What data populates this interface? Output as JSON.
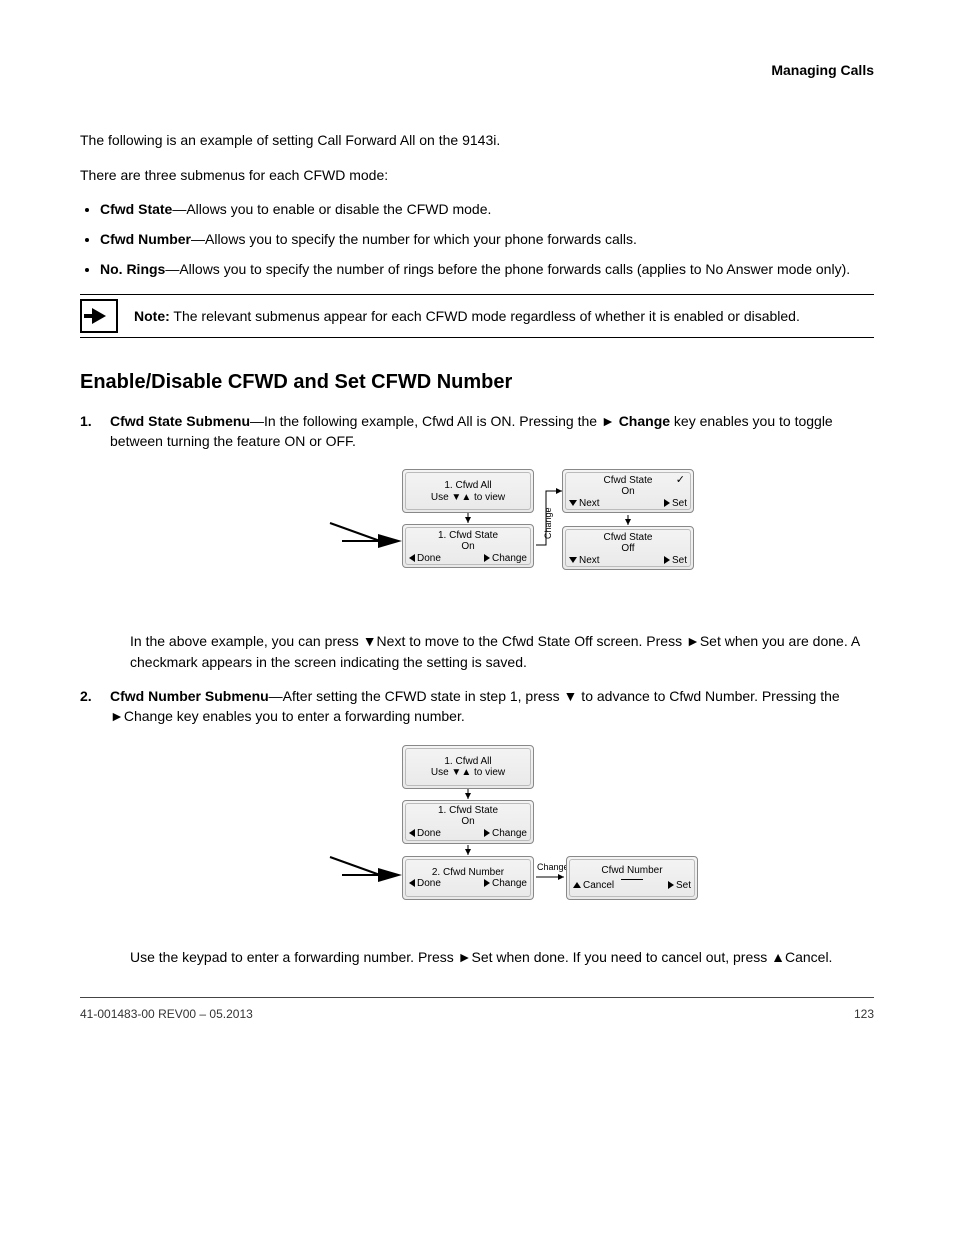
{
  "header": {
    "right": "Managing Calls"
  },
  "intro_lines": [
    "The following is an example of setting Call Forward All on the 9143i.",
    "There are three submenus for each CFWD mode:"
  ],
  "submenu_items": [
    {
      "term": "Cfwd State",
      "desc": "—Allows you to enable or disable the CFWD mode."
    },
    {
      "term": "Cfwd Number",
      "desc": "—Allows you to specify the number for which your phone forwards calls."
    },
    {
      "term": "No. Rings",
      "desc": "—Allows you to specify the number of rings before the phone forwards calls (applies to No Answer mode only)."
    }
  ],
  "note": {
    "label": "Note:",
    "text": "The relevant submenus appear for each CFWD mode regardless of whether it is enabled or disabled."
  },
  "section_title": "Enable/Disable CFWD and Set CFWD Number",
  "steps": [
    {
      "num": "1.",
      "label": "Cfwd State Submenu",
      "body": "—In the following example, Cfwd All is ON. Pressing the ",
      "bold_inline": "► Change",
      "body2": " key enables you to toggle between turning the feature ON or OFF. "
    }
  ],
  "step_followups": [
    "In the above example, you can press ▼Next to move to the Cfwd State Off screen. Press ►Set when you are done. A checkmark appears in the screen indicating the setting is saved."
  ],
  "step2": {
    "num": "2.",
    "label": "Cfwd Number Submenu",
    "body": "—After setting the CFWD state in step 1, press ▼ to advance to Cfwd Number. Pressing the ►Change key enables you to enter a forwarding number."
  },
  "step2_followup": "Use the keypad to enter a forwarding number. Press ►Set when done. If you need to cancel out, press ▲Cancel.",
  "diagram1": {
    "b1": {
      "l1": "1. Cfwd All",
      "l2": "Use ▼▲ to view"
    },
    "b2": {
      "l1": "1. Cfwd State",
      "l1b": "On",
      "left": "Done",
      "right": "Change"
    },
    "b3": {
      "l1": "Cfwd State",
      "l1b": "On",
      "left": "Next",
      "right": "Set"
    },
    "b4": {
      "l1": "Cfwd State",
      "l1b": "Off",
      "left": "Next",
      "right": "Set"
    },
    "edge_label": "Change"
  },
  "diagram2": {
    "b1": {
      "l1": "1. Cfwd All",
      "l2": "Use ▼▲ to view"
    },
    "b2": {
      "l1": "1. Cfwd State",
      "l1b": "On",
      "left": "Done",
      "right": "Change"
    },
    "b3": {
      "l1": "2. Cfwd Number",
      "left": "Done",
      "right": "Change"
    },
    "b4": {
      "l1": "Cfwd Number",
      "left": "Cancel",
      "right": "Set"
    },
    "edge_label": "Change"
  },
  "footer": {
    "left": "41-001483-00 REV00 – 05.2013",
    "right": "123"
  }
}
